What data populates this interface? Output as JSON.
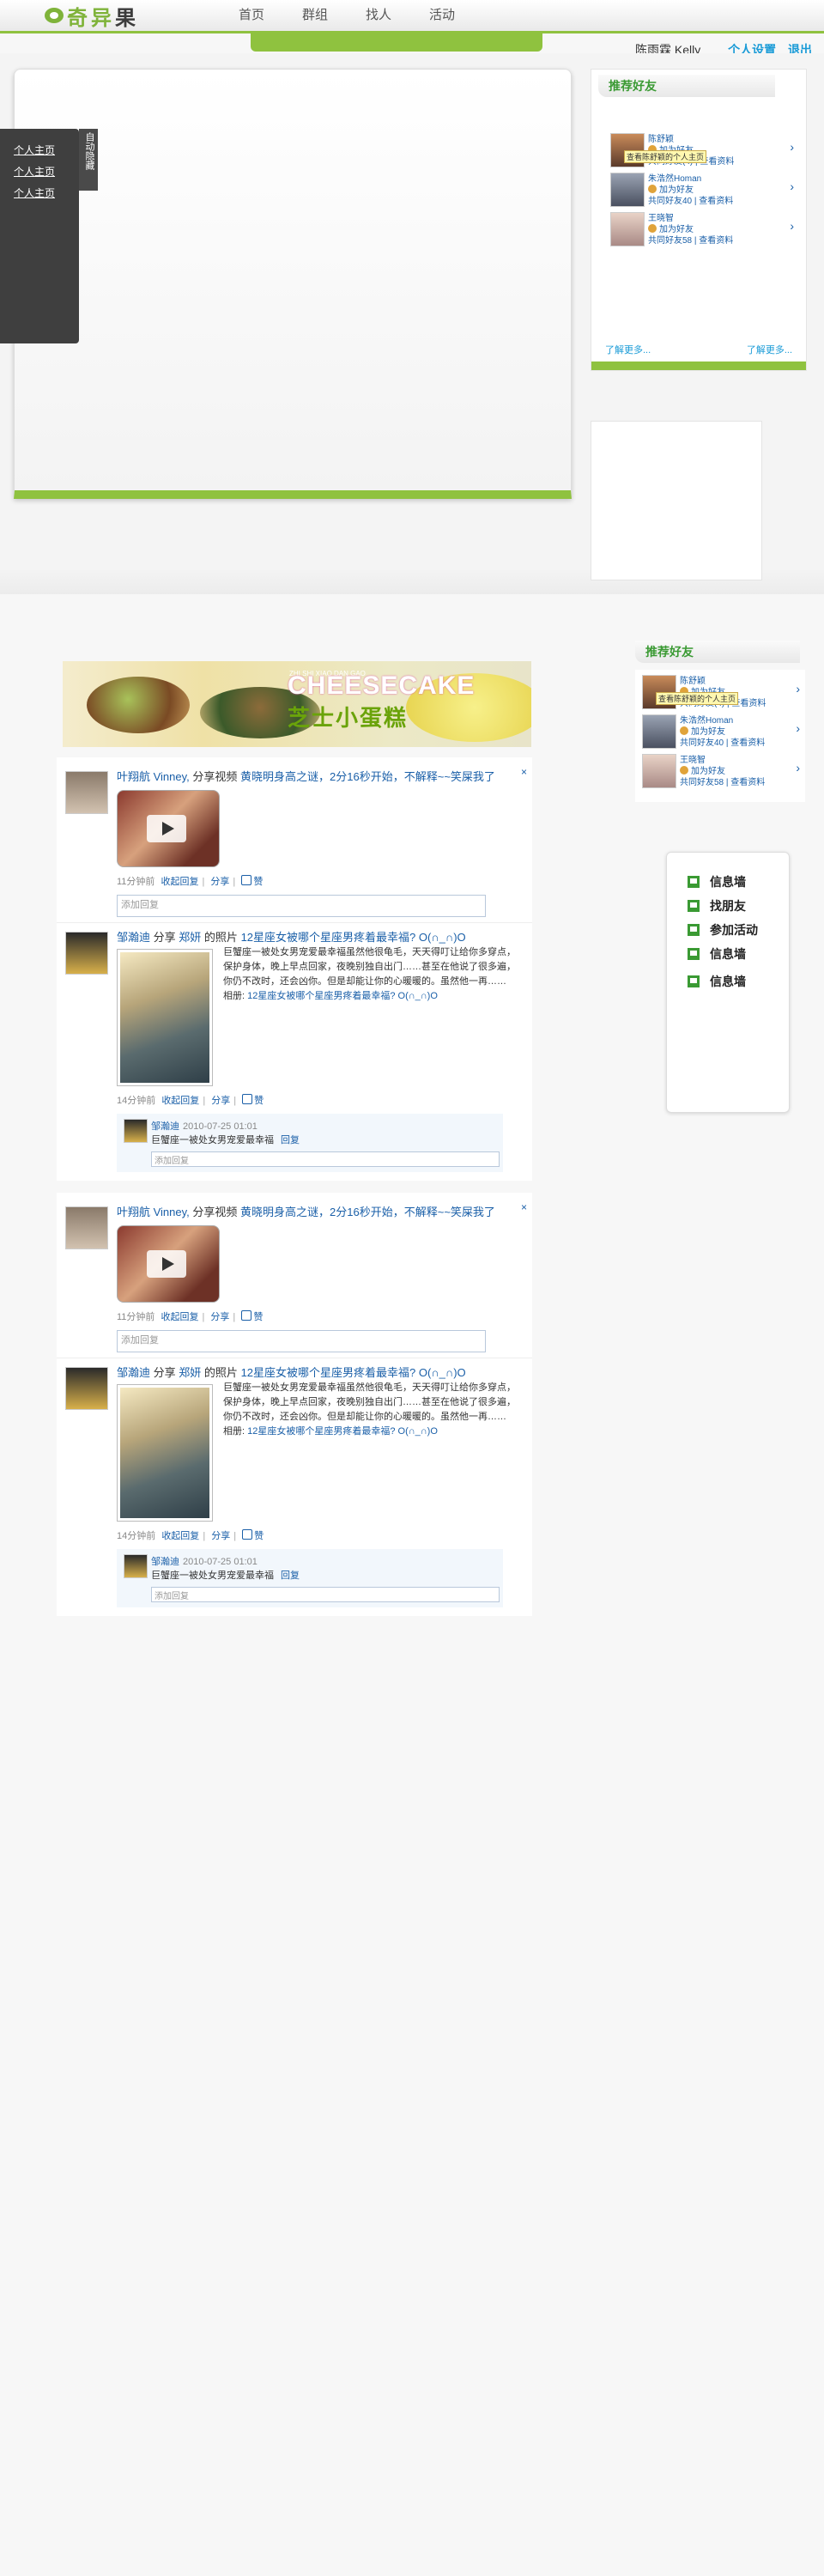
{
  "brand": {
    "logo_text_main": "奇异",
    "logo_text_last": "果"
  },
  "nav": {
    "items": [
      "首页",
      "群组",
      "找人",
      "活动"
    ]
  },
  "userbar": {
    "username": "陈雨霖 Kelly",
    "settings": "个人设置",
    "logout": "退出"
  },
  "left_menu": {
    "links": [
      "个人主页",
      "个人主页",
      "个人主页"
    ],
    "hide_tab": "自动隐藏"
  },
  "recommend_panel": {
    "title": "推荐好友",
    "friends": [
      {
        "name": "陈舒颖",
        "add": "加为好友",
        "common": "共同好友(4)",
        "view": "查看资料",
        "tooltip": "查看陈舒颖的个人主页"
      },
      {
        "name": "朱浩然Homan",
        "add": "加为好友",
        "common": "共同好友40",
        "view": "查看资料"
      },
      {
        "name": "王晓智",
        "add": "加为好友",
        "common": "共同好友58",
        "view": "查看资料"
      }
    ],
    "more_left": "了解更多...",
    "more_right": "了解更多..."
  },
  "recommend_panel_2": {
    "title": "推荐好友",
    "friends": [
      {
        "name": "陈舒颖",
        "add": "加为好友",
        "common": "共同好友(4)",
        "view": "查看资料",
        "tooltip": "查看陈舒颖的个人主页"
      },
      {
        "name": "朱浩然Homan",
        "add": "加为好友",
        "common": "共同好友40",
        "view": "查看资料"
      },
      {
        "name": "王晓智",
        "add": "加为好友",
        "common": "共同好友58",
        "view": "查看资料"
      }
    ]
  },
  "banner": {
    "en": "CHEESECAKE",
    "sub": "ZHI SHI XIAO DAN GAO",
    "cn": "芝士小蛋糕"
  },
  "feed_blocks": [
    {
      "video_post": {
        "author": "叶翔航 Vinney,",
        "verb": "分享视频",
        "title": "黄晓明身高之谜，2分16秒开始，不解释~~笑屎我了",
        "close": "×",
        "time": "11分钟前",
        "reply_action": "收起回复",
        "share": "分享",
        "like": "赞",
        "comment_placeholder": "添加回复"
      },
      "photo_post": {
        "author": "邹瀚迪",
        "verb": "分享",
        "target": "郑妍",
        "verb2": "的照片",
        "title": "12星座女被哪个星座男疼着最幸福? O(∩_∩)O",
        "desc": "巨蟹座一被处女男宠爱最幸福虽然他很龟毛，天天得叮让给你多穿点，保护身体，晚上早点回家，夜晚别独自出门……甚至在他说了很多遍，你仍不改时，还会凶你。但是却能让你的心暖暖的。虽然他一再……",
        "album_label": "相册:",
        "album": "12星座女被哪个星座男疼着最幸福? O(∩_∩)O",
        "time": "14分钟前",
        "reply_action": "收起回复",
        "share": "分享",
        "like": "赞",
        "reply": {
          "name": "邹瀚迪",
          "time": "2010-07-25 01:01",
          "text": "巨蟹座一被处女男宠爱最幸福",
          "reply_link": "回复",
          "placeholder": "添加回复"
        }
      }
    },
    {
      "video_post": {
        "author": "叶翔航 Vinney,",
        "verb": "分享视频",
        "title": "黄晓明身高之谜，2分16秒开始，不解释~~笑屎我了",
        "close": "×",
        "time": "11分钟前",
        "reply_action": "收起回复",
        "share": "分享",
        "like": "赞",
        "comment_placeholder": "添加回复"
      },
      "photo_post": {
        "author": "邹瀚迪",
        "verb": "分享",
        "target": "郑妍",
        "verb2": "的照片",
        "title": "12星座女被哪个星座男疼着最幸福? O(∩_∩)O",
        "desc": "巨蟹座一被处女男宠爱最幸福虽然他很龟毛，天天得叮让给你多穿点，保护身体，晚上早点回家，夜晚别独自出门……甚至在他说了很多遍，你仍不改时，还会凶你。但是却能让你的心暖暖的。虽然他一再……",
        "album_label": "相册:",
        "album": "12星座女被哪个星座男疼着最幸福? O(∩_∩)O",
        "time": "14分钟前",
        "reply_action": "收起回复",
        "share": "分享",
        "like": "赞",
        "reply": {
          "name": "邹瀚迪",
          "time": "2010-07-25 01:01",
          "text": "巨蟹座一被处女男宠爱最幸福",
          "reply_link": "回复",
          "placeholder": "添加回复"
        }
      }
    }
  ],
  "quick_menu": {
    "items": [
      "信息墙",
      "找朋友",
      "参加活动",
      "信息墙",
      "信息墙"
    ]
  },
  "colors": {
    "brand_green": "#8fc23f",
    "link_blue": "#1a5fa8",
    "accent_blue": "#1a9bd7"
  }
}
